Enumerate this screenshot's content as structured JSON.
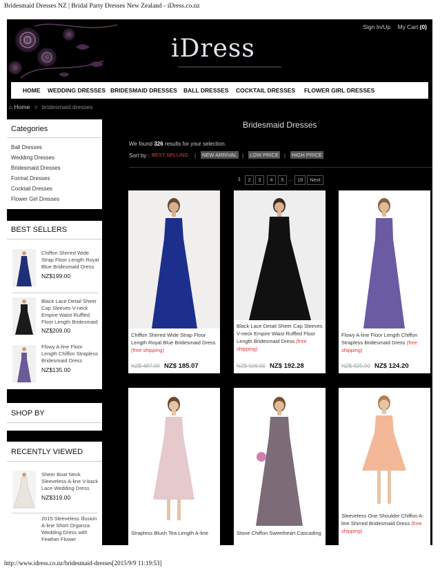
{
  "browser": {
    "page_title": "Bridesmaid Dresses NZ | Bridal Party Dresses New Zealand - iDress.co.nz",
    "footer_url": "http://www.idress.co.nz/bridesmaid-dresses[2015/9/9 11:19:53]"
  },
  "header": {
    "logo": "iDress",
    "sign_in": "Sign In/Up",
    "cart_label": "My Cart",
    "cart_count": "(0)"
  },
  "nav": {
    "items": [
      "HOME",
      "WEDDING DRESSES",
      "BRIDESMAID DRESSES",
      "BALL DRESSES",
      "COCKTAIL DRESSES",
      "FLOWER GIRL DRESSES"
    ]
  },
  "breadcrumb": {
    "home": "Home",
    "sep": ">",
    "current": "bridesmaid dresses"
  },
  "sidebar": {
    "categories_title": "Categories",
    "categories": [
      "Ball Dresses",
      "Wedding Dresses",
      "Bridesmaid Dresses",
      "Formal Dresses",
      "Cocktail Dresses",
      "Flower Girl Dresses"
    ],
    "best_sellers_title": "BEST SELLERS",
    "best_sellers": [
      {
        "title": "Chiffon Shirred Wide Strap Floor Length Royal Blue Bridesmaid Dress",
        "price": "NZ$199.00",
        "color": "#1f2f7a"
      },
      {
        "title": "Black Lace Detail Sheer Cap Sleeves V-neck Empire Waist Ruffled Floor Length Bridesmaid",
        "price": "NZ$209.00",
        "color": "#1a1a1a"
      },
      {
        "title": "Flowy A-line Floor Length Chiffon Strapless Bridesmaid Dress",
        "price": "NZ$135.00",
        "color": "#6a5a9a"
      }
    ],
    "shop_by_title": "SHOP BY",
    "recent_title": "RECENTLY VIEWED",
    "recent": [
      {
        "title": "Sheer Boat Neck Sleeveless A-line V-back Lace Wedding Dress",
        "price": "NZ$319.00",
        "color": "#e9e4dc"
      },
      {
        "title": "2015 Sleeveless Illusion A-line Short Organza Wedding Dress with Feather Flower",
        "price": "",
        "color": "#ffffff"
      }
    ]
  },
  "main": {
    "title": "Bridesmaid Dresses",
    "found_pre": "We found",
    "found_count": "326",
    "found_post": "results for your selection.",
    "sort_label": "Sort by :",
    "sort_options": [
      "BEST SELLING",
      "NEW ARRIVAL",
      "LOW PRICE",
      "HIGH PRICE"
    ],
    "sort_sep": "|",
    "pagination": [
      "1",
      "2",
      "3",
      "4",
      "5",
      "...",
      "19",
      "Next"
    ],
    "products": [
      {
        "name": "Chiffon Shirred Wide Strap Floor Length Royal Blue Bridesmaid Dress",
        "shipping": "(free shipping)",
        "old": "NZ$ 487.00",
        "price": "NZ$ 185.07",
        "color": "#1d2f8c"
      },
      {
        "name": "Black Lace Detail Sheer Cap Sleeves V-neck Empire Waist Ruffled Floor Length Bridesmaid Dress",
        "shipping": "(free shipping)",
        "old": "NZ$ 506.00",
        "price": "NZ$ 192.28",
        "color": "#111111"
      },
      {
        "name": "Flowy A-line Floor Length Chiffon Strapless Bridesmaid Dress",
        "shipping": "(free shipping)",
        "old": "NZ$ 325.00",
        "price": "NZ$ 124.20",
        "color": "#6b5ba3"
      },
      {
        "name": "Strapless Blush Tea Length A-line",
        "shipping": "",
        "old": "",
        "price": "",
        "color": "#e6c9cc"
      },
      {
        "name": "Stone Chiffon Sweetheart Cascading",
        "shipping": "",
        "old": "",
        "price": "",
        "color": "#7c6c78"
      },
      {
        "name": "Sleeveless One Shoulder Chiffon A-line Shirred Bridesmaid Dress",
        "shipping": "(free shipping)",
        "old": "",
        "price": "",
        "color": "#f2b898"
      }
    ]
  },
  "colors": {
    "active_sort": "#e04040",
    "sort_box": "#555555",
    "free_shipping": "#e63030"
  }
}
